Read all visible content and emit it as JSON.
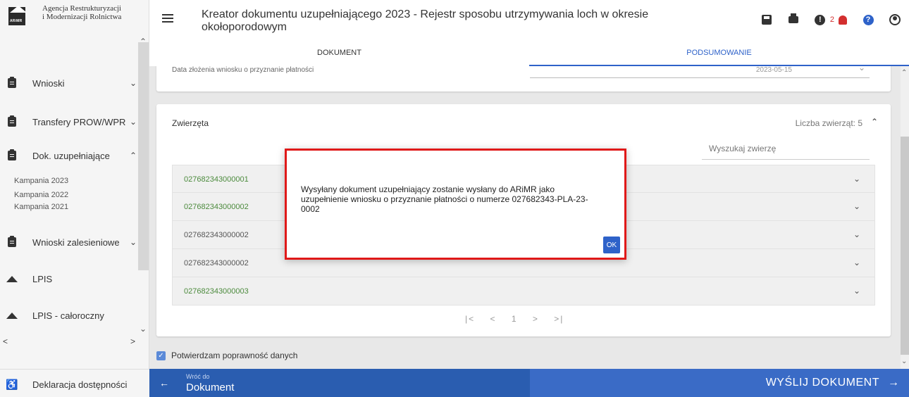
{
  "logo": {
    "line1": "Agencja Restrukturyzacji",
    "line2": "i Modernizacji Rolnictwa",
    "mark": "ARiMR"
  },
  "sidebar": {
    "items": [
      {
        "label": "Wnioski",
        "chevron": "⌄",
        "icon": "clipboard-icon"
      },
      {
        "label": "Transfery PROW/WPR",
        "chevron": "⌄",
        "icon": "clipboard-icon"
      },
      {
        "label": "Dok. uzupełniające",
        "chevron": "⌃",
        "icon": "clipboard-icon"
      },
      {
        "label": "Wnioski zalesieniowe",
        "chevron": "⌄",
        "icon": "clipboard-icon"
      },
      {
        "label": "LPIS",
        "icon": "mountain-icon"
      },
      {
        "label": "LPIS - całoroczny",
        "icon": "mountain-icon"
      }
    ],
    "subitems": [
      "Kampania 2023",
      "Kampania 2022",
      "Kampania 2021"
    ],
    "footer": "Deklaracja dostępności"
  },
  "header": {
    "title": "Kreator dokumentu uzupełniającego 2023 - Rejestr sposobu utrzymywania loch w okresie okołoporodowym",
    "notification_count": "2"
  },
  "tabs": [
    {
      "label": "DOKUMENT"
    },
    {
      "label": "PODSUMOWANIE"
    }
  ],
  "top_card": {
    "label": "Data złożenia wniosku o przyznanie płatności",
    "value": "2023-05-15"
  },
  "animals": {
    "title": "Zwierzęta",
    "count_label": "Liczba zwierząt: 5",
    "search_placeholder": "Wyszukaj zwierzę",
    "rows": [
      {
        "id": "027682343000001",
        "color": "green"
      },
      {
        "id": "027682343000002",
        "color": "green"
      },
      {
        "id": "027682343000002",
        "color": "grey"
      },
      {
        "id": "027682343000002",
        "color": "grey"
      },
      {
        "id": "027682343000003",
        "color": "green"
      }
    ],
    "pager": {
      "first": "|<",
      "prev": "<",
      "page": "1",
      "next": ">",
      "last": ">|"
    }
  },
  "confirm": {
    "label": "Potwierdzam poprawność danych",
    "checked": true
  },
  "footer": {
    "back_small": "Wróć do",
    "back_big": "Dokument",
    "send": "WYŚLIJ DOKUMENT"
  },
  "modal": {
    "message": "Wysyłany dokument uzupełniający zostanie wysłany do ARiMR jako uzupełnienie wniosku o przyznanie płatności o numerze 027682343-PLA-23-0002",
    "ok": "OK"
  },
  "colors": {
    "primary": "#2e62c9",
    "footer_left": "#2a5db0",
    "footer_right": "#3a6bc6",
    "modal_border": "#e01919",
    "id_green": "#4b8a3c"
  }
}
